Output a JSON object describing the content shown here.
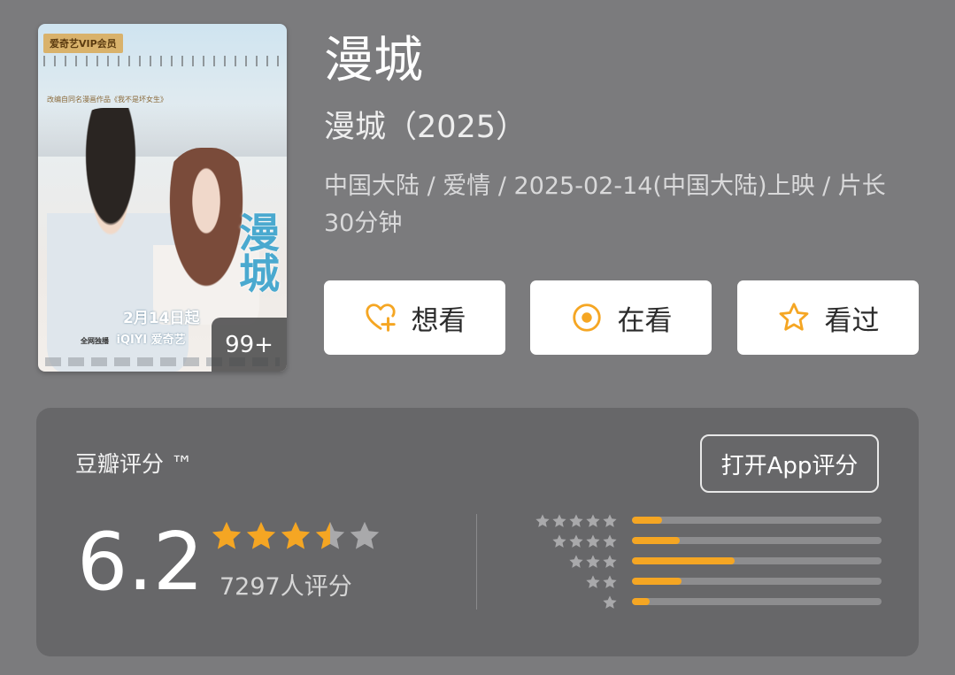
{
  "poster": {
    "vip_tag": "爱奇艺VIP会员",
    "subtitle_line": "改编自同名漫画作品《我不是坏女生》",
    "title_art": "漫城",
    "release_text": "2月14日起",
    "platform_tag": "全网独播",
    "platform_text": "iQIYI 爱奇艺",
    "photo_badge": "99+"
  },
  "movie": {
    "title": "漫城",
    "original_title": "漫城（2025）",
    "meta": "中国大陆 / 爱情 / 2025-02-14(中国大陆)上映 / 片长30分钟"
  },
  "actions": {
    "want": "想看",
    "watching": "在看",
    "watched": "看过"
  },
  "rating": {
    "header": "豆瓣评分 ™",
    "open_app": "打开App评分",
    "score": "6.2",
    "stars_out_of_5": 3.5,
    "count_text": "7297人评分",
    "distribution": [
      {
        "stars": 5,
        "fraction": 0.12
      },
      {
        "stars": 4,
        "fraction": 0.19
      },
      {
        "stars": 3,
        "fraction": 0.41
      },
      {
        "stars": 2,
        "fraction": 0.2
      },
      {
        "stars": 1,
        "fraction": 0.07
      }
    ]
  },
  "colors": {
    "background": "#7b7b7d",
    "card": "#676769",
    "accent": "#f5a623",
    "star_empty": "#a9a9ab",
    "track": "#8d8d8f"
  }
}
